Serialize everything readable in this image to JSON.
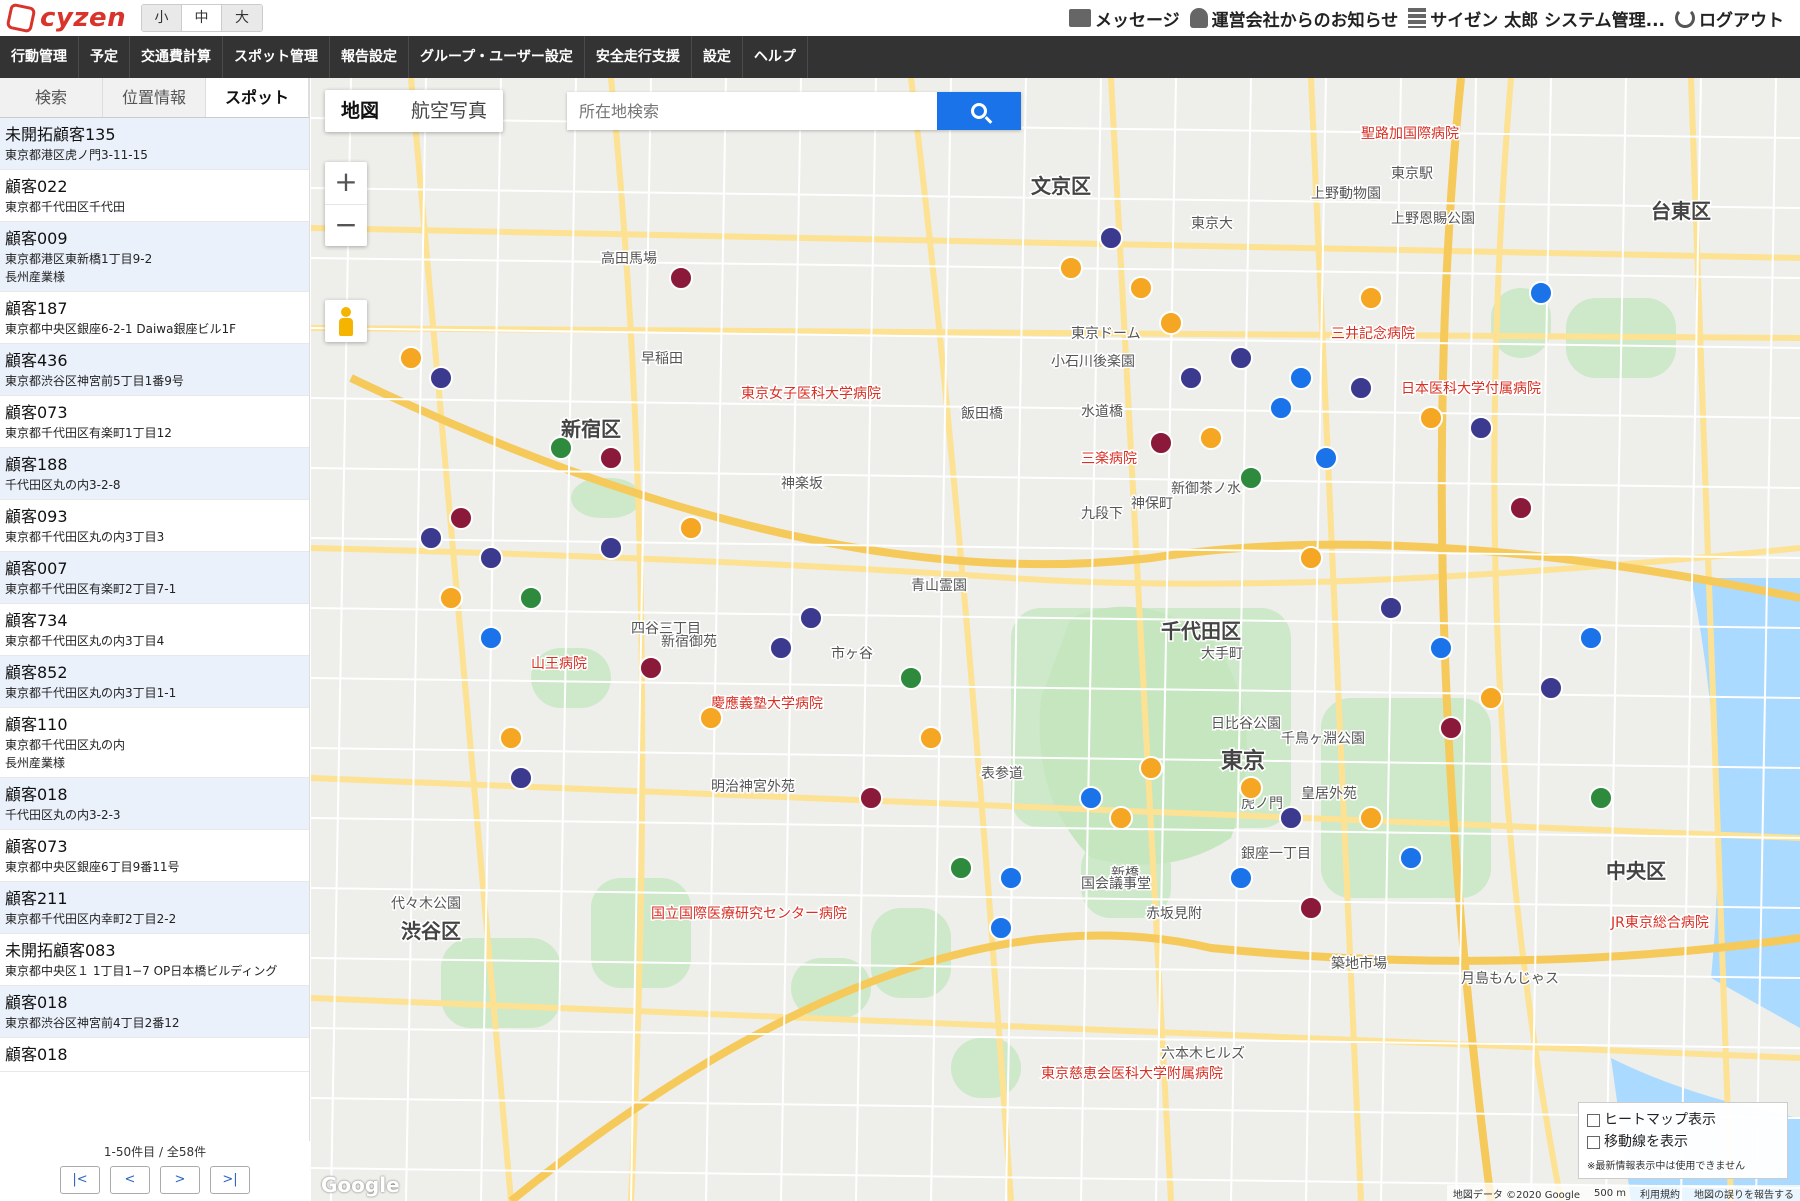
{
  "header": {
    "logo_text": "cyzen",
    "font_sizes": [
      "小",
      "中",
      "大"
    ],
    "message": "メッセージ",
    "notice": "運営会社からのお知らせ",
    "user": "サイゼン 太郎 システム管理...",
    "logout": "ログアウト"
  },
  "nav": [
    "行動管理",
    "予定",
    "交通費計算",
    "スポット管理",
    "報告設定",
    "グループ・ユーザー設定",
    "安全走行支援",
    "設定",
    "ヘルプ"
  ],
  "sidebar": {
    "tabs": [
      "検索",
      "位置情報",
      "スポット"
    ],
    "active_tab": "スポット",
    "items": [
      {
        "name": "未開拓顧客135",
        "address": "東京都港区虎ノ門3-11-15"
      },
      {
        "name": "顧客022",
        "address": "東京都千代田区千代田"
      },
      {
        "name": "顧客009",
        "address": "東京都港区東新橋1丁目9-2",
        "address2": "長州産業様"
      },
      {
        "name": "顧客187",
        "address": "東京都中央区銀座6-2-1 Daiwa銀座ビル1F"
      },
      {
        "name": "顧客436",
        "address": "東京都渋谷区神宮前5丁目1番9号"
      },
      {
        "name": "顧客073",
        "address": "東京都千代田区有楽町1丁目12"
      },
      {
        "name": "顧客188",
        "address": "千代田区丸の内3-2-8"
      },
      {
        "name": "顧客093",
        "address": "東京都千代田区丸の内3丁目3"
      },
      {
        "name": "顧客007",
        "address": "東京都千代田区有楽町2丁目7-1"
      },
      {
        "name": "顧客734",
        "address": "東京都千代田区丸の内3丁目4"
      },
      {
        "name": "顧客852",
        "address": "東京都千代田区丸の内3丁目1-1"
      },
      {
        "name": "顧客110",
        "address": "東京都千代田区丸の内",
        "address2": "長州産業様"
      },
      {
        "name": "顧客018",
        "address": "千代田区丸の内3-2-3"
      },
      {
        "name": "顧客073",
        "address": "東京都中央区銀座6丁目9番11号"
      },
      {
        "name": "顧客211",
        "address": "東京都千代田区内幸町2丁目2-2"
      },
      {
        "name": "未開拓顧客083",
        "address": "東京都中央区１ 1丁目1−7 OP日本橋ビルディング"
      },
      {
        "name": "顧客018",
        "address": "東京都渋谷区神宮前4丁目2番12"
      },
      {
        "name": "顧客018",
        "address": ""
      }
    ],
    "pager_info": "1-50件目 / 全58件",
    "pager_buttons": [
      "|<",
      "<",
      ">",
      ">|"
    ]
  },
  "map": {
    "type_buttons": [
      "地図",
      "航空写真"
    ],
    "search_placeholder": "所在地検索",
    "zoom_in": "+",
    "zoom_out": "−",
    "heatmap_label": "ヒートマップ表示",
    "route_label": "移動線を表示",
    "note": "※最新情報表示中は使用できません",
    "attribution": [
      "地図データ ©2020 Google",
      "500 m",
      "利用規約",
      "地図の誤りを報告する"
    ],
    "google": "Google",
    "labels": [
      {
        "text": "文京区",
        "size": 20,
        "bold": true
      },
      {
        "text": "台東区",
        "size": 20,
        "bold": true
      },
      {
        "text": "新宿区",
        "size": 20,
        "bold": true
      },
      {
        "text": "千代田区",
        "size": 20,
        "bold": true
      },
      {
        "text": "渋谷区",
        "size": 20,
        "bold": true
      },
      {
        "text": "中央区",
        "size": 20,
        "bold": true
      },
      {
        "text": "東京大",
        "size": 14
      },
      {
        "text": "上野恩賜公園",
        "size": 14
      },
      {
        "text": "上野動物園",
        "size": 14
      },
      {
        "text": "小石川後楽園",
        "size": 14
      },
      {
        "text": "水道橋",
        "size": 14
      },
      {
        "text": "飯田橋",
        "size": 14
      },
      {
        "text": "九段下",
        "size": 14
      },
      {
        "text": "神保町",
        "size": 14
      },
      {
        "text": "新御茶ノ水",
        "size": 14
      },
      {
        "text": "大手町",
        "size": 14
      },
      {
        "text": "東京",
        "size": 22,
        "bold": true
      },
      {
        "text": "皇居外苑",
        "size": 14
      },
      {
        "text": "日比谷公園",
        "size": 14
      },
      {
        "text": "銀座一丁目",
        "size": 14
      },
      {
        "text": "新橋",
        "size": 14
      },
      {
        "text": "虎ノ門",
        "size": 14
      },
      {
        "text": "赤坂見附",
        "size": 14
      },
      {
        "text": "国会議事堂",
        "size": 14
      },
      {
        "text": "六本木ヒルズ",
        "size": 14
      },
      {
        "text": "明治神宮外苑",
        "size": 14
      },
      {
        "text": "新宿御苑",
        "size": 14
      },
      {
        "text": "四谷三丁目",
        "size": 14
      },
      {
        "text": "市ヶ谷",
        "size": 14
      },
      {
        "text": "神楽坂",
        "size": 14
      },
      {
        "text": "高田馬場",
        "size": 14
      },
      {
        "text": "早稲田",
        "size": 14
      },
      {
        "text": "東京ドーム",
        "size": 14
      },
      {
        "text": "築地市場",
        "size": 14
      },
      {
        "text": "月島もんじゃス",
        "size": 14
      },
      {
        "text": "東京慈恵会医科大学附属病院",
        "size": 14,
        "red": true
      },
      {
        "text": "慶應義塾大学病院",
        "size": 14,
        "red": true
      },
      {
        "text": "東京女子医科大学病院",
        "size": 14,
        "red": true
      },
      {
        "text": "三楽病院",
        "size": 14,
        "red": true
      },
      {
        "text": "三井記念病院",
        "size": 14,
        "red": true
      },
      {
        "text": "日本医科大学付属病院",
        "size": 14,
        "red": true
      },
      {
        "text": "聖路加国際病院",
        "size": 14,
        "red": true
      },
      {
        "text": "JR東京総合病院",
        "size": 14,
        "red": true
      },
      {
        "text": "山王病院",
        "size": 14,
        "red": true
      },
      {
        "text": "国立国際医療研究センター病院",
        "size": 14,
        "red": true
      },
      {
        "text": "代々木公園",
        "size": 14
      },
      {
        "text": "青山霊園",
        "size": 14
      },
      {
        "text": "表参道",
        "size": 14
      },
      {
        "text": "千鳥ヶ淵公園",
        "size": 14
      },
      {
        "text": "東京駅",
        "size": 14
      }
    ]
  }
}
